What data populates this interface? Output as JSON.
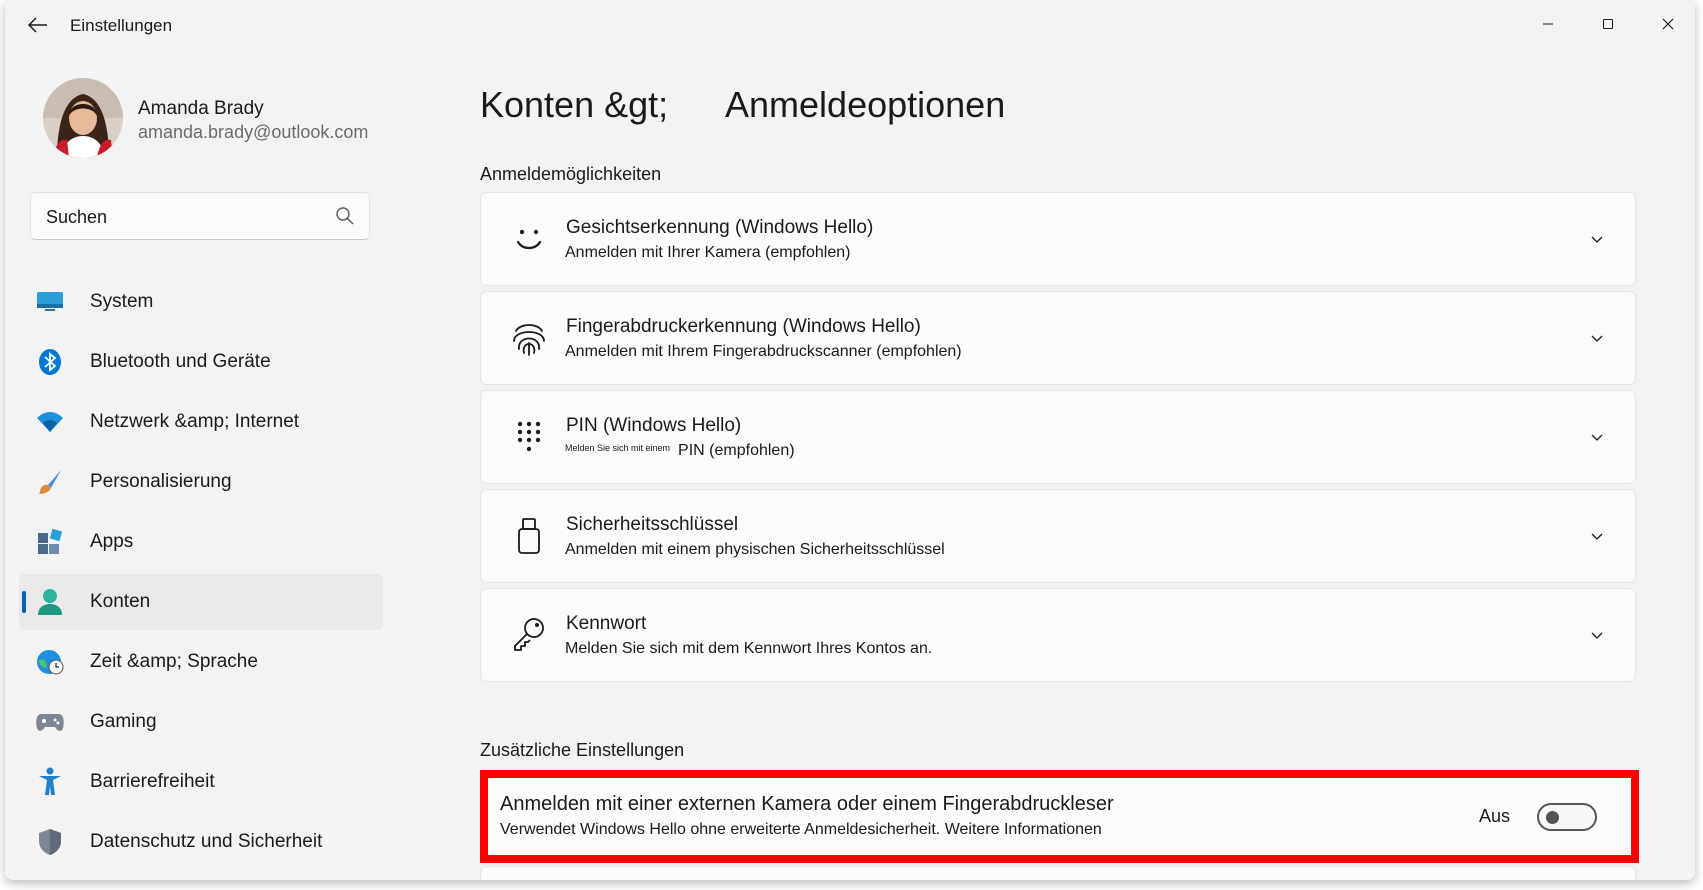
{
  "window": {
    "title": "Einstellungen"
  },
  "profile": {
    "name": "Amanda Brady",
    "email": "amanda.brady@outlook.com"
  },
  "search": {
    "value": "Suchen",
    "icon": "search-icon"
  },
  "nav": {
    "items": [
      {
        "label": "System",
        "icon": "system-icon",
        "color": "#2b9ed8"
      },
      {
        "label": "Bluetooth und Geräte",
        "icon": "bluetooth-icon",
        "color": "#0078d4"
      },
      {
        "label": "Netzwerk &amp; Internet",
        "icon": "wifi-icon",
        "color": "#1f8fe0"
      },
      {
        "label": "Personalisierung",
        "icon": "brush-icon",
        "color": "#e08a3a"
      },
      {
        "label": "Apps",
        "icon": "apps-icon",
        "color": "#4a6a8c"
      },
      {
        "label": "Konten",
        "icon": "account-icon",
        "color": "#2bb5a0",
        "active": true
      },
      {
        "label": "Zeit &amp; Sprache",
        "icon": "globe-clock-icon",
        "color": "#1f8fe0"
      },
      {
        "label": "Gaming",
        "icon": "gamepad-icon",
        "color": "#7b8794"
      },
      {
        "label": "Barrierefreiheit",
        "icon": "accessibility-icon",
        "color": "#1f7fc8"
      },
      {
        "label": "Datenschutz und Sicherheit",
        "icon": "shield-icon",
        "color": "#7b8794"
      }
    ]
  },
  "header": {
    "breadcrumb_parent": "Konten",
    "breadcrumb_sep": "&gt;",
    "breadcrumb_current": "Anmeldeoptionen"
  },
  "sign_in": {
    "section_title": "Anmeldemöglichkeiten",
    "cards": [
      {
        "title": "Gesichtserkennung (Windows Hello)",
        "subtitle": "Anmelden mit Ihrer Kamera (empfohlen)",
        "icon": "face-icon"
      },
      {
        "title": "Fingerabdruckerkennung (Windows Hello)",
        "subtitle": "Anmelden mit Ihrem Fingerabdruckscanner (empfohlen)",
        "icon": "fingerprint-icon"
      },
      {
        "title": "PIN (Windows Hello)",
        "subtitle_prefix": "Melden Sie sich mit einem",
        "subtitle": "PIN (empfohlen)",
        "icon": "pin-keypad-icon"
      },
      {
        "title": "Sicherheitsschlüssel",
        "subtitle": "Anmelden mit einem physischen Sicherheitsschlüssel",
        "icon": "usb-key-icon"
      },
      {
        "title": "Kennwort",
        "subtitle": "Melden Sie sich mit dem Kennwort Ihres Kontos an.",
        "icon": "key-icon"
      }
    ]
  },
  "additional": {
    "section_title": "Zusätzliche Einstellungen",
    "external": {
      "title": "Anmelden mit einer externen Kamera oder einem Fingerabdruckleser",
      "subtitle": "Verwendet Windows Hello ohne erweiterte Anmeldesicherheit.",
      "link": "Weitere Informationen",
      "toggle_label": "Aus",
      "toggle_on": false,
      "highlight_color": "#ff0000"
    }
  }
}
